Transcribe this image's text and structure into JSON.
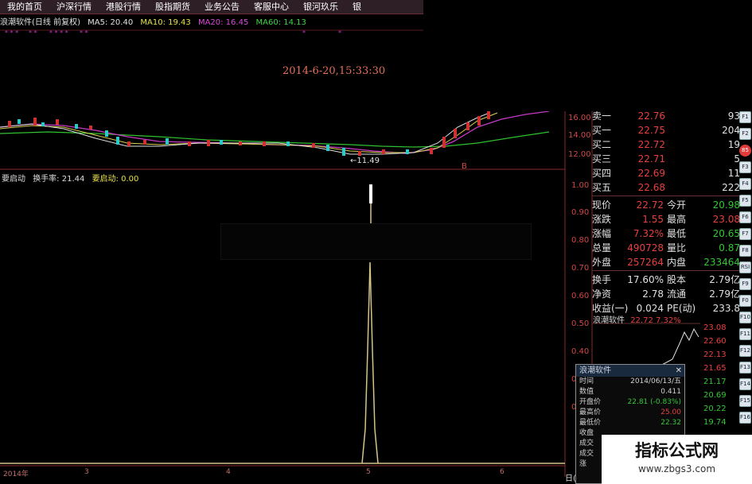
{
  "menu": [
    "我的首页",
    "沪深行情",
    "港股行情",
    "股指期货",
    "业务公告",
    "客服中心",
    "银河玖乐",
    "银"
  ],
  "header": {
    "stock_title": "浪潮软件(日线 前复权)",
    "ma5": "MA5: 20.40",
    "ma10": "MA10: 19.43",
    "ma20": "MA20: 16.45",
    "ma60": "MA60: 14.13"
  },
  "date_display": "2014-6-20,15:33:30",
  "price_axis": [
    "16.00",
    "14.00",
    "12.00"
  ],
  "low_label": "←11.49",
  "indicator": {
    "name": "要启动",
    "turnover_label": "换手率: 21.44",
    "signal_label": "要启动: 0.00"
  },
  "indicator_axis": [
    "1.00",
    "0.90",
    "0.80",
    "0.70",
    "0.60",
    "0.50",
    "0.40",
    "0.30",
    "0.20"
  ],
  "order_book": [
    {
      "label": "卖一",
      "price": "22.76",
      "vol": "93"
    },
    {
      "label": "买一",
      "price": "22.75",
      "vol": "204"
    },
    {
      "label": "买二",
      "price": "22.72",
      "vol": "19"
    },
    {
      "label": "买三",
      "price": "22.71",
      "vol": "5"
    },
    {
      "label": "买四",
      "price": "22.69",
      "vol": "11"
    },
    {
      "label": "买五",
      "price": "22.68",
      "vol": "222"
    }
  ],
  "stats": [
    {
      "l1": "现价",
      "v1": "22.72",
      "l2": "今开",
      "v2": "20.98",
      "c1": "r",
      "c2": "g"
    },
    {
      "l1": "涨跌",
      "v1": "1.55",
      "l2": "最高",
      "v2": "23.08",
      "c1": "r",
      "c2": "r"
    },
    {
      "l1": "涨幅",
      "v1": "7.32%",
      "l2": "最低",
      "v2": "20.65",
      "c1": "r",
      "c2": "g"
    },
    {
      "l1": "总量",
      "v1": "490728",
      "l2": "量比",
      "v2": "0.87",
      "c1": "r",
      "c2": "g"
    },
    {
      "l1": "外盘",
      "v1": "257264",
      "l2": "内盘",
      "v2": "233464",
      "c1": "r",
      "c2": "g"
    }
  ],
  "stats2": [
    {
      "l1": "换手",
      "v1": "17.60%",
      "l2": "股本",
      "v2": "2.79亿"
    },
    {
      "l1": "净资",
      "v1": "2.78",
      "l2": "流通",
      "v2": "2.79亿"
    },
    {
      "l1": "收益(一)",
      "v1": "0.024",
      "l2": "PE(动)",
      "v2": "233.8"
    }
  ],
  "ticker": {
    "name": "浪潮软件",
    "price": "22.72",
    "pct": "7.32%"
  },
  "mini_axis": [
    "23.08",
    "22.60",
    "22.13",
    "21.65",
    "21.17",
    "20.69",
    "20.22",
    "19.74"
  ],
  "popup": {
    "title": "浪潮软件",
    "rows": [
      {
        "label": "时间",
        "value": "2014/06/13/五",
        "c": ""
      },
      {
        "label": "数值",
        "value": "0.411",
        "c": ""
      },
      {
        "label": "开盘价",
        "value": "22.81 (-0.83%)",
        "c": "g"
      },
      {
        "label": "最高价",
        "value": "25.00",
        "c": "r"
      },
      {
        "label": "最低价",
        "value": "22.32",
        "c": "g"
      },
      {
        "label": "收盘",
        "value": "",
        "c": ""
      },
      {
        "label": "成交",
        "value": "",
        "c": ""
      },
      {
        "label": "成交",
        "value": "",
        "c": ""
      },
      {
        "label": "涨",
        "value": "",
        "c": ""
      }
    ]
  },
  "watermark": {
    "title": "指标公式网",
    "url": "www.zbgs3.com"
  },
  "bottom_axis": [
    "2014年",
    "3",
    "4",
    "5",
    "6"
  ],
  "right_corner": "日(",
  "sidebar_icons": [
    "F1",
    "F2",
    "85",
    "F3",
    "F4",
    "F5",
    "F6",
    "F7",
    "F8",
    "RSI",
    "F9",
    "F0",
    "F10",
    "F11",
    "F12",
    "F13",
    "F14",
    "F15",
    "F16"
  ]
}
